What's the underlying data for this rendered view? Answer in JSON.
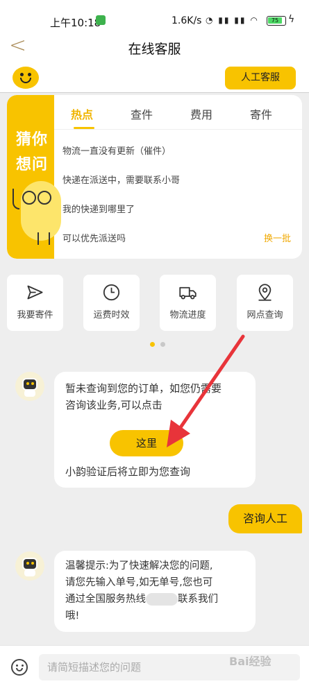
{
  "status_bar": {
    "time": "上午10:18",
    "speed": "1.6K/s",
    "battery": "75"
  },
  "nav": {
    "title": "在线客服"
  },
  "header": {
    "human_service": "人工客服"
  },
  "guess": {
    "side_line1": "猜你",
    "side_line2": "想问",
    "tabs": [
      "热点",
      "查件",
      "费用",
      "寄件"
    ],
    "active_tab": 0,
    "questions": [
      "物流一直没有更新（催件）",
      "快递在派送中，需要联系小哥",
      "我的快递到哪里了",
      "可以优先派送吗"
    ],
    "refresh": "换一批"
  },
  "shortcuts": [
    {
      "label": "我要寄件",
      "icon": "paper-plane-icon"
    },
    {
      "label": "运费时效",
      "icon": "clock-icon"
    },
    {
      "label": "物流进度",
      "icon": "truck-icon"
    },
    {
      "label": "网点查询",
      "icon": "location-pin-icon"
    }
  ],
  "pager": {
    "count": 2,
    "active": 0
  },
  "messages": {
    "bot1_line1": "暂未查询到您的订单，如您仍需要",
    "bot1_line2": "咨询该业务,可以点击",
    "bot1_button": "这里",
    "bot1_foot": "小韵验证后将立即为您查询",
    "user1": "咨询人工",
    "bot2_line1": "温馨提示:为了快速解决您的问题,",
    "bot2_line2": "请您先输入单号,如无单号,您也可",
    "bot2_line3_pre": "通过全国服务热线",
    "bot2_line3_post": "联系我们",
    "bot2_line4": "哦!"
  },
  "input": {
    "placeholder": "请简短描述您的问题"
  },
  "colors": {
    "accent": "#f8c300",
    "arrow": "#e8343a"
  },
  "watermark": "Bai经验"
}
